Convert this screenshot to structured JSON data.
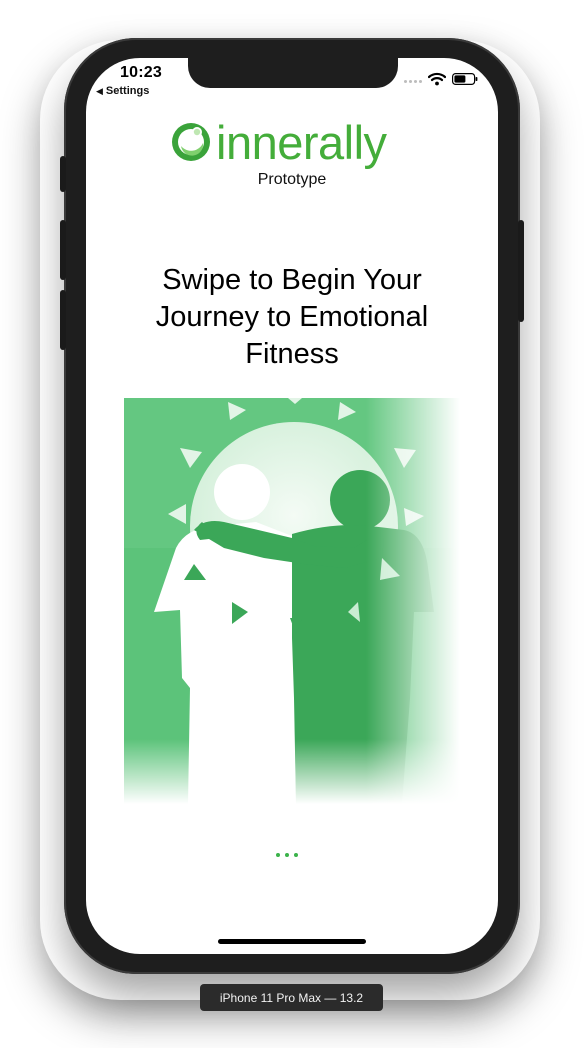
{
  "status_bar": {
    "time": "10:23",
    "back_label": "Settings",
    "back_icon": "back-triangle-icon",
    "signal_icon": "cellular-signal-icon",
    "wifi_icon": "wifi-icon",
    "battery_icon": "battery-icon"
  },
  "brand": {
    "logo_text": "innerally",
    "subtitle": "Prototype",
    "color": "#44ad3a"
  },
  "onboarding": {
    "headline": "Swipe to Begin Your Journey to Emotional Fitness",
    "image_description_icon": "two-friends-illustration",
    "page_count": 3,
    "accent": "#3bb34a"
  },
  "simulator": {
    "device_label": "iPhone 11 Pro Max — 13.2"
  }
}
